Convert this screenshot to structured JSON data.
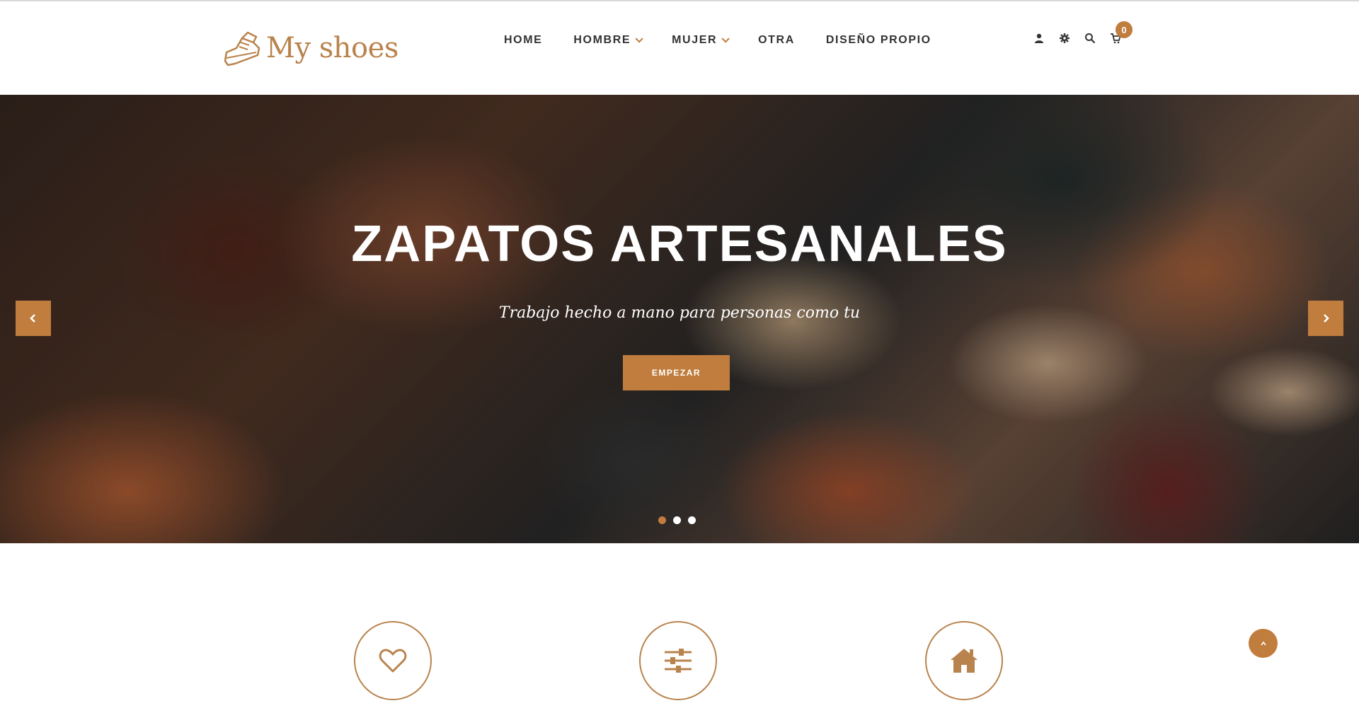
{
  "brand": {
    "name": "My shoes",
    "accent": "#c07d3e"
  },
  "nav": {
    "items": [
      {
        "label": "HOME",
        "dropdown": false
      },
      {
        "label": "HOMBRE",
        "dropdown": true
      },
      {
        "label": "MUJER",
        "dropdown": true
      },
      {
        "label": "OTRA",
        "dropdown": false
      },
      {
        "label": "DISEÑO PROPIO",
        "dropdown": false
      }
    ]
  },
  "tools": {
    "icons": [
      "user-icon",
      "gear-icon",
      "search-icon",
      "cart-icon"
    ],
    "cart_count": "0"
  },
  "hero": {
    "title": "ZAPATOS ARTESANALES",
    "subtitle": "Trabajo hecho a mano para personas como tu",
    "button": "EMPEZAR",
    "slide_count": 3,
    "active_slide": 1
  },
  "features": {
    "icons": [
      "heart-icon",
      "sliders-icon",
      "home-icon"
    ]
  }
}
